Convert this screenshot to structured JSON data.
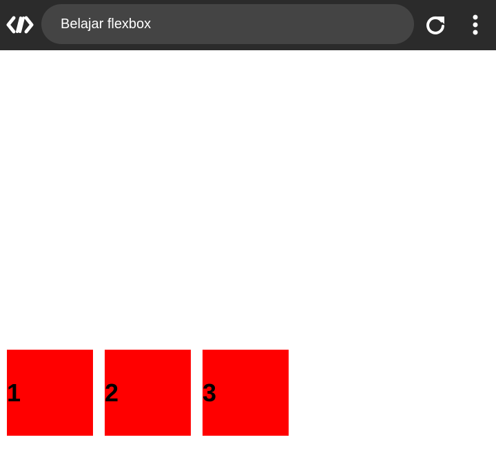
{
  "browser": {
    "address_text": "Belajar flexbox",
    "icons": {
      "logo": "code-logo-icon",
      "reload": "reload-icon",
      "menu": "more-vert-icon"
    },
    "colors": {
      "toolbar": "#2b2b2b",
      "address_bar": "#444444",
      "text": "#ffffff"
    }
  },
  "page": {
    "boxes": [
      {
        "label": "1"
      },
      {
        "label": "2"
      },
      {
        "label": "3"
      }
    ],
    "colors": {
      "box_background": "#ff0000",
      "box_text": "#000000",
      "background": "#ffffff"
    }
  }
}
